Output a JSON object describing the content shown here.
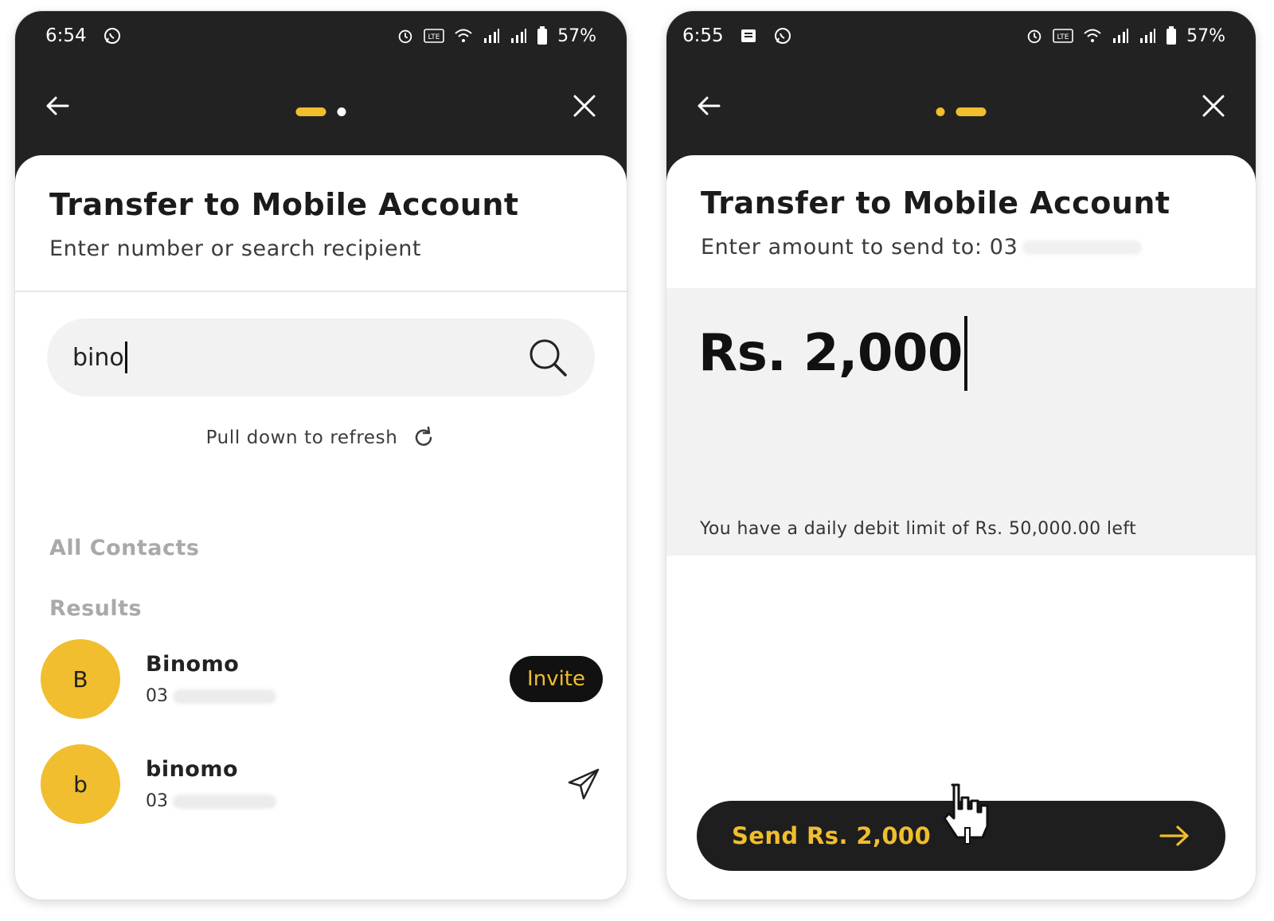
{
  "left_screen": {
    "status_bar": {
      "time": "6:54",
      "battery": "57%"
    },
    "title": "Transfer to Mobile Account",
    "subtitle": "Enter number or search recipient",
    "search": {
      "value": "bino"
    },
    "refresh_text": "Pull down to refresh",
    "section_all_contacts": "All Contacts",
    "section_results": "Results",
    "contacts": [
      {
        "initial": "B",
        "name": "Binomo",
        "number_prefix": "03",
        "action": "Invite"
      },
      {
        "initial": "b",
        "name": "binomo",
        "number_prefix": "03"
      }
    ],
    "progress_step": 1
  },
  "right_screen": {
    "status_bar": {
      "time": "6:55",
      "battery": "57%"
    },
    "title": "Transfer to Mobile Account",
    "subtitle": "Enter amount to send to: 03",
    "amount": "Rs. 2,000",
    "limit_text": "You have a daily debit limit of Rs. 50,000.00 left",
    "send_button": "Send Rs. 2,000",
    "progress_step": 2
  },
  "colors": {
    "accent": "#f0be2e",
    "dark": "#222222",
    "panel": "#f2f2f2"
  },
  "icons": [
    "whatsapp-icon",
    "alarm-icon",
    "volte-icon",
    "wifi-icon",
    "signal-icon",
    "battery-icon",
    "back-arrow-icon",
    "close-icon",
    "search-icon",
    "refresh-icon",
    "send-icon",
    "arrow-right-icon",
    "hand-cursor-icon",
    "message-icon"
  ]
}
